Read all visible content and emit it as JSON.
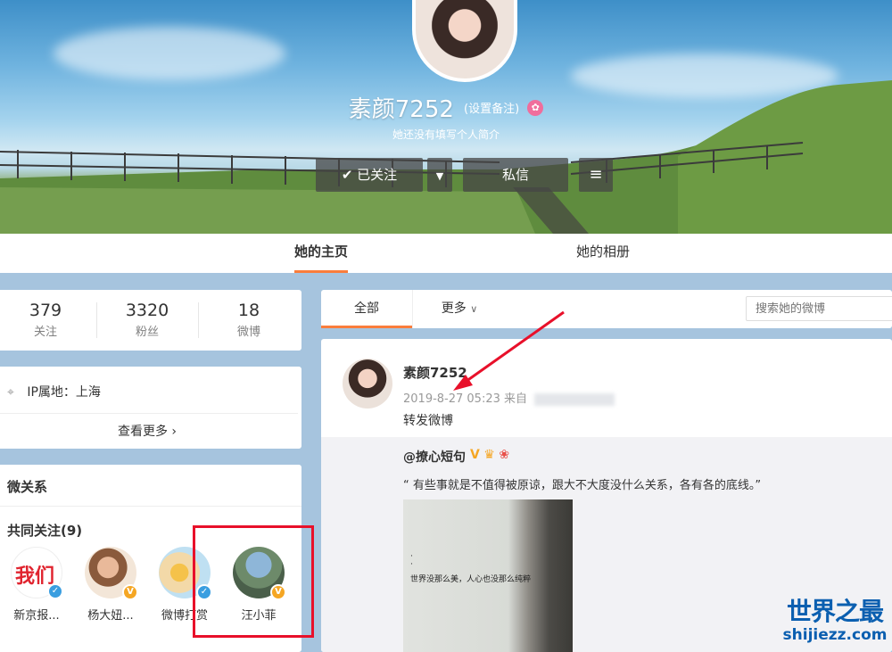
{
  "profile": {
    "name": "素颜7252",
    "remark_link": "(设置备注)",
    "intro": "她还没有填写个人简介",
    "follow_button": "已关注",
    "message_button": "私信"
  },
  "tabs": [
    {
      "label": "她的主页",
      "active": true
    },
    {
      "label": "她的相册",
      "active": false
    }
  ],
  "stats": [
    {
      "value": "379",
      "label": "关注"
    },
    {
      "value": "3320",
      "label": "粉丝"
    },
    {
      "value": "18",
      "label": "微博"
    }
  ],
  "info": {
    "ip": "IP属地：上海",
    "more": "查看更多 ›"
  },
  "relations": {
    "title": "微关系",
    "common_follow": "共同关注(9)",
    "friends": [
      {
        "name": "新京报...",
        "badge_color": "#3a9ee0"
      },
      {
        "name": "杨大妞...",
        "badge_color": "#f5a623"
      },
      {
        "name": "微博打赏",
        "badge_color": "#3a9ee0"
      },
      {
        "name": "汪小菲",
        "badge_color": "#f5a623"
      }
    ]
  },
  "filter": {
    "all": "全部",
    "more": "更多",
    "search_placeholder": "搜索她的微博"
  },
  "post": {
    "user": "素颜7252",
    "time": "2019-8-27 05:23",
    "source_prefix": "来自",
    "text": "转发微博",
    "repost": {
      "user": "@撩心短句",
      "text": "“ 有些事就是不值得被原谅，跟大不大度没什么关系，各有各的底线。”",
      "image_line": "世界没那么美，人心也没那么纯粹"
    }
  },
  "watermark": {
    "title": "世界之最",
    "domain": "shijiezz.com"
  },
  "colors": {
    "accent": "#fa7d3c",
    "highlight_box": "#e8102a",
    "page_bg": "#a6c4de"
  }
}
